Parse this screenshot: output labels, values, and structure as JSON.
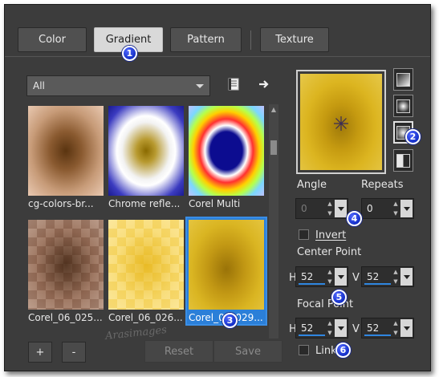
{
  "tabs": [
    {
      "label": "Color",
      "active": false
    },
    {
      "label": "Gradient",
      "active": true
    },
    {
      "label": "Pattern",
      "active": false
    },
    {
      "label": "Texture",
      "active": false
    }
  ],
  "category_select": {
    "value": "All"
  },
  "gradients": [
    {
      "label": "cg-colors-br...",
      "selected": false
    },
    {
      "label": "Chrome refle...",
      "selected": false
    },
    {
      "label": "Corel Multi",
      "selected": false
    },
    {
      "label": "Corel_06_025...",
      "selected": false
    },
    {
      "label": "Corel_06_026...",
      "selected": false
    },
    {
      "label": "Corel_06_029...",
      "selected": true
    }
  ],
  "buttons": {
    "add": "+",
    "remove": "-",
    "reset": "Reset",
    "save": "Save"
  },
  "angle": {
    "label": "Angle",
    "value": "0"
  },
  "repeats": {
    "label": "Repeats",
    "value": "0"
  },
  "invert": {
    "label": "Invert",
    "checked": false
  },
  "center_point": {
    "label": "Center Point",
    "h_label": "H",
    "v_label": "V",
    "h": "52",
    "v": "52"
  },
  "focal_point": {
    "label": "Focal Point",
    "h_label": "H",
    "v_label": "V",
    "h": "52",
    "v": "52"
  },
  "link": {
    "label": "Link",
    "checked": false
  },
  "callouts": [
    "1",
    "2",
    "3",
    "4",
    "5",
    "6"
  ],
  "watermark": "Arasimages",
  "colors": {
    "accent": "#2b7fd8",
    "badge": "#1530c8",
    "dialog_bg": "#3c3c3c"
  }
}
